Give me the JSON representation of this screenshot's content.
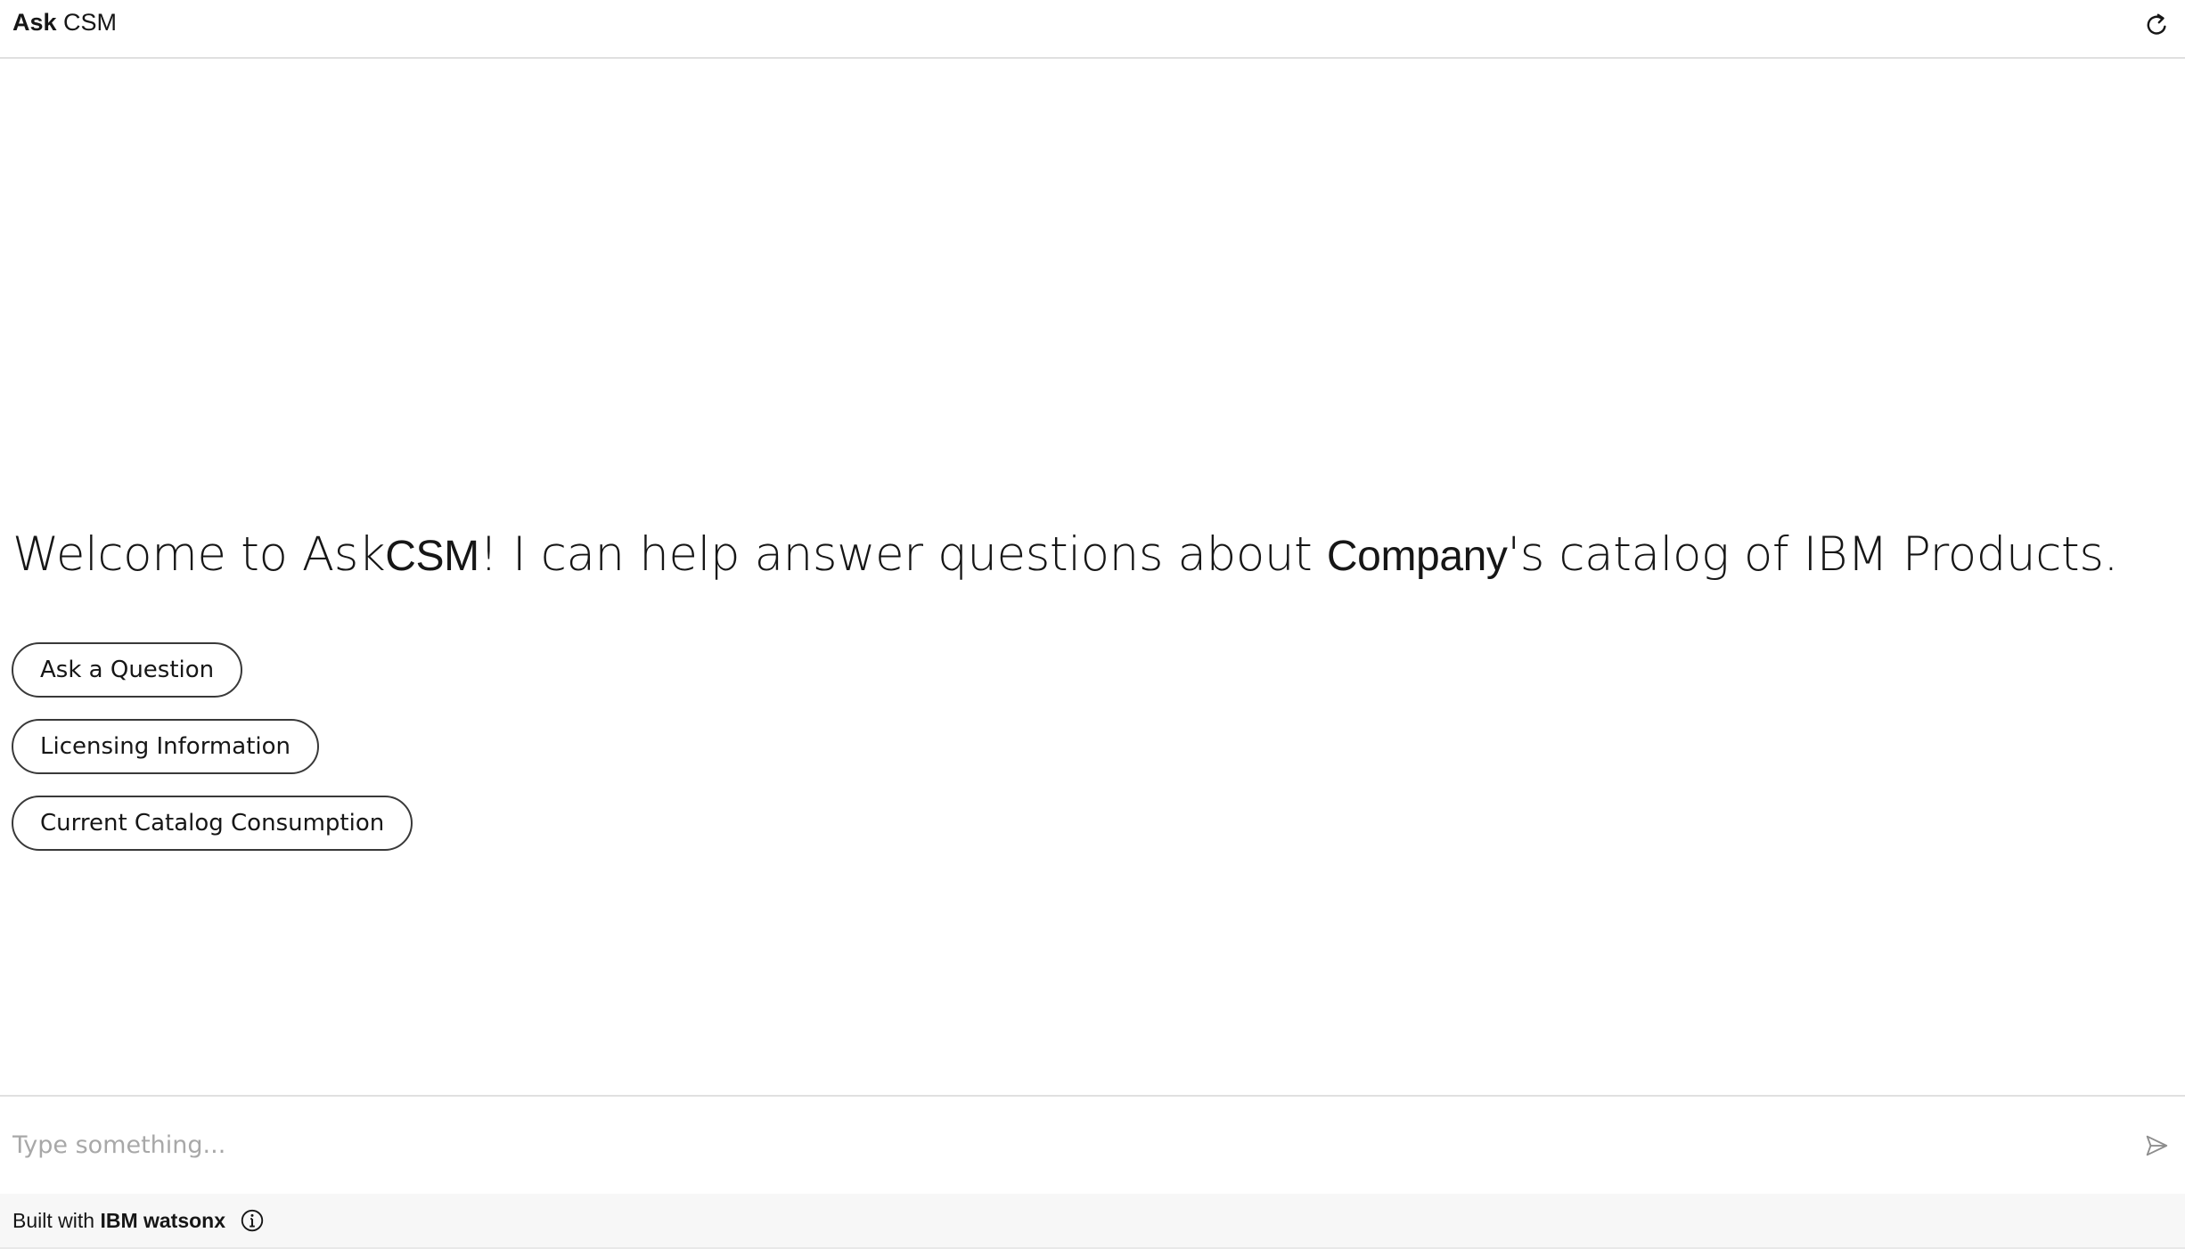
{
  "header": {
    "title_bold": "Ask",
    "title_regular": "CSM",
    "refresh_icon": "refresh-icon"
  },
  "main": {
    "welcome": {
      "part1": "Welcome to Ask",
      "brand": "CSM",
      "part2": "! I can help answer questions about ",
      "company": "Company",
      "part3": "'s catalog of IBM Products."
    },
    "quick_replies": [
      {
        "label": "Ask a Question"
      },
      {
        "label": "Licensing Information"
      },
      {
        "label": "Current Catalog Consumption"
      }
    ]
  },
  "input": {
    "placeholder": "Type something...",
    "value": "",
    "send_icon": "send-icon"
  },
  "footer": {
    "prefix": "Built with ",
    "product": "IBM watsonx",
    "info_icon": "info-icon"
  },
  "colors": {
    "text": "#161616",
    "border": "#e0e0e0",
    "placeholder": "#a8a8a8",
    "button_border": "#393939",
    "footer_bg": "#f7f7f7"
  }
}
